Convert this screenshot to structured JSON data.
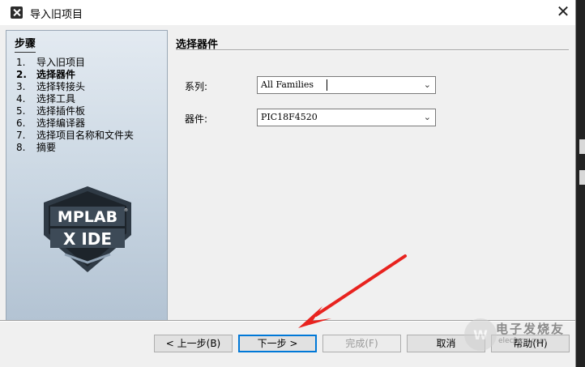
{
  "window": {
    "title": "导入旧项目",
    "close_glyph": "✕"
  },
  "sidebar": {
    "title": "步骤",
    "steps": [
      {
        "num": "1.",
        "label": "导入旧项目",
        "current": false
      },
      {
        "num": "2.",
        "label": "选择器件",
        "current": true
      },
      {
        "num": "3.",
        "label": "选择转接头",
        "current": false
      },
      {
        "num": "4.",
        "label": "选择工具",
        "current": false
      },
      {
        "num": "5.",
        "label": "选择插件板",
        "current": false
      },
      {
        "num": "6.",
        "label": "选择编译器",
        "current": false
      },
      {
        "num": "7.",
        "label": "选择项目名称和文件夹",
        "current": false
      },
      {
        "num": "8.",
        "label": "摘要",
        "current": false
      }
    ],
    "logo_text": {
      "line1": "MPLAB",
      "line2": "X IDE",
      "mark": "®"
    }
  },
  "content": {
    "title": "选择器件",
    "family_label": "系列:",
    "family_value": "All Families",
    "device_label": "器件:",
    "device_value": "PIC18F4520"
  },
  "buttons": {
    "back": "< 上一步(B)",
    "next": "下一步 >",
    "finish": "完成(F)",
    "cancel": "取消",
    "help": "帮助(H)"
  },
  "watermark": {
    "text": "电子发烧友",
    "url": "elecfans.com"
  },
  "colors": {
    "annotation_arrow": "#e8231f",
    "focus_border": "#0078d7"
  }
}
